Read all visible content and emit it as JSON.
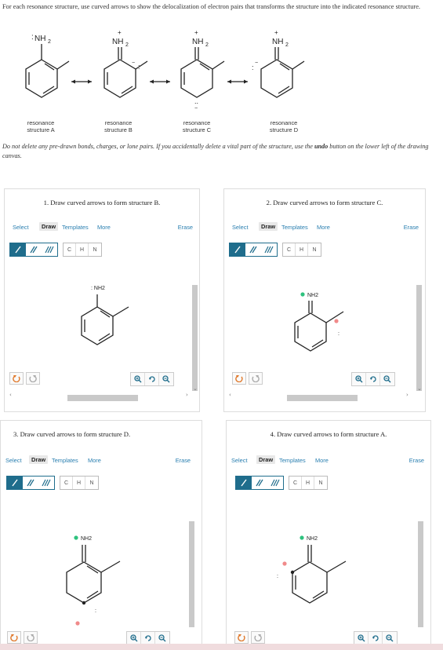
{
  "intro": {
    "text": "For each resonance structure, use curved arrows to show the delocalization of electron pairs that transforms the structure into the indicated resonance structure."
  },
  "resonance": [
    {
      "label": "resonance\nstructure A",
      "atom": ": NH2"
    },
    {
      "label": "resonance\nstructure B",
      "atom": "NH2"
    },
    {
      "label": "resonance\nstructure C",
      "atom": "NH2"
    },
    {
      "label": "resonance\nstructure D",
      "atom": "NH2"
    }
  ],
  "note": {
    "before": "Do not delete any pre-drawn bonds, charges, or lone pairs. If you accidentally delete a vital part of the structure, use the ",
    "bold": "undo",
    "after": " button on the lower left of the drawing canvas."
  },
  "toolbar": {
    "select": "Select",
    "draw": "Draw",
    "templates": "Templates",
    "more": "More",
    "erase": "Erase",
    "atoms": [
      "C",
      "H",
      "N"
    ]
  },
  "panels": [
    {
      "title": "1. Draw curved arrows to form structure B.",
      "atom_label": ": NH2"
    },
    {
      "title": "2. Draw curved arrows to form structure C.",
      "atom_label": "NH2"
    },
    {
      "title": "3. Draw curved arrows to form structure D.",
      "atom_label": "NH2"
    },
    {
      "title": "4. Draw curved arrows to form structure A.",
      "atom_label": "NH2"
    }
  ],
  "icons": {
    "undo": "undo-icon",
    "redo": "redo-icon",
    "zoom_in": "zoom-in-icon",
    "reset": "reset-icon",
    "zoom_out": "zoom-out-icon"
  },
  "colors": {
    "accent": "#1f6d8c",
    "link": "#2a7fb0",
    "positive_charge": "#2ec27e",
    "negative_charge": "#f08a8a"
  }
}
